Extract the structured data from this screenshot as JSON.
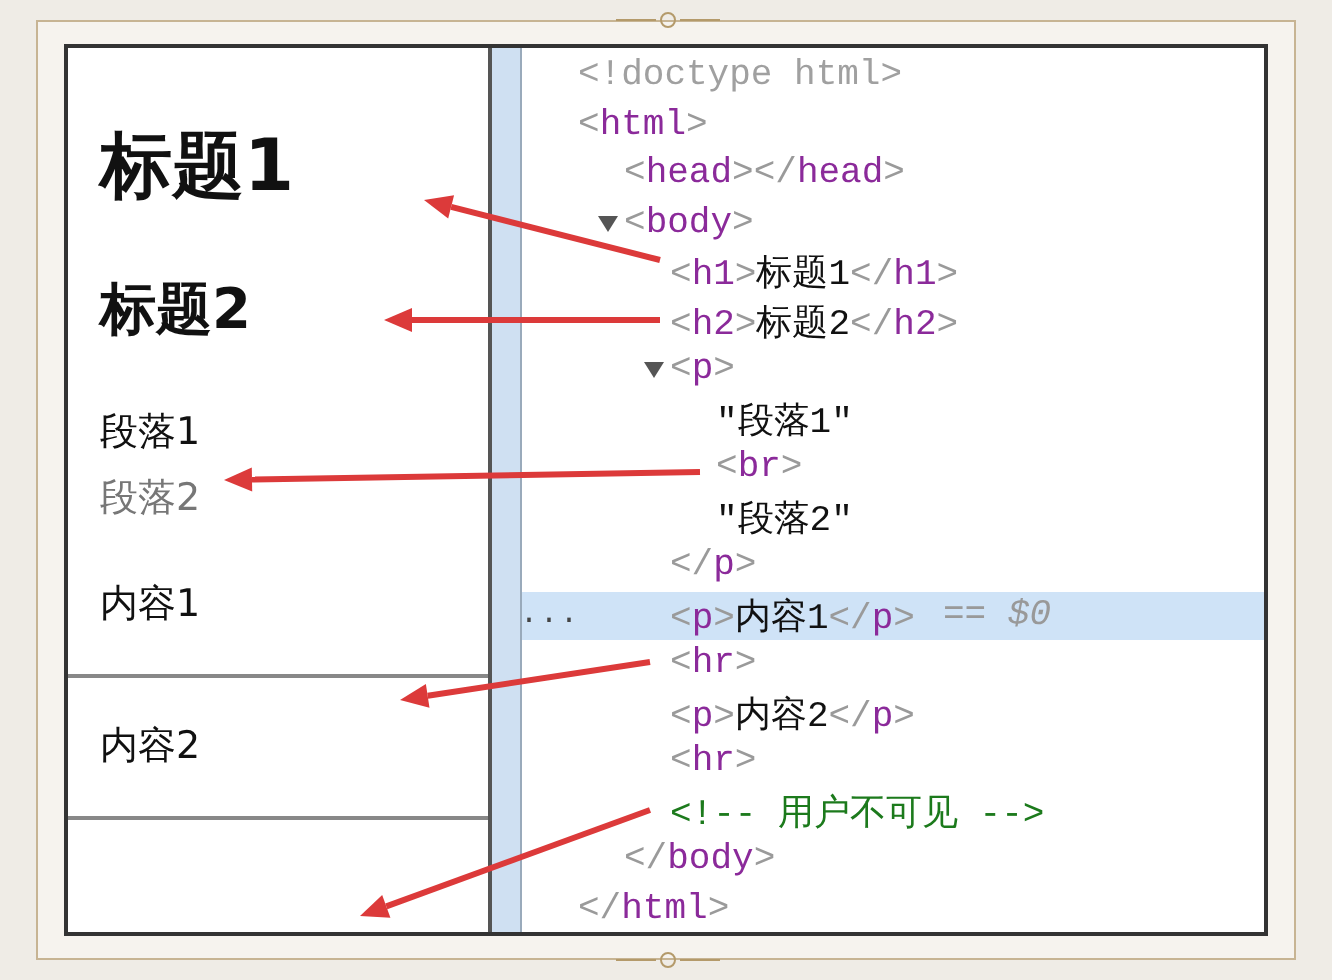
{
  "preview": {
    "items": [
      {
        "kind": "heading1",
        "text": "标题1"
      },
      {
        "kind": "heading2",
        "text": "标题2"
      },
      {
        "kind": "paragraph",
        "text": "段落1"
      },
      {
        "kind": "faded",
        "text": "段落2"
      },
      {
        "kind": "paragraph",
        "text": "内容1"
      },
      {
        "kind": "rule"
      },
      {
        "kind": "paragraph",
        "text": "内容2"
      },
      {
        "kind": "rule"
      }
    ]
  },
  "dom_tree": {
    "nodes": [
      {
        "kind": "doctype",
        "open": "<!doctype html>",
        "selected": false
      },
      {
        "kind": "element",
        "open": "<html>",
        "closing": "</html>",
        "selected": false,
        "children": [
          {
            "kind": "element",
            "open": "<head>",
            "close": "</head>",
            "selected": false
          },
          {
            "kind": "element",
            "open": "<body>",
            "closing": "</body>",
            "expanded": true,
            "selected": false,
            "children": [
              {
                "kind": "element",
                "open": "<h1>",
                "content": "标题1",
                "close": "</h1>",
                "selected": false
              },
              {
                "kind": "element",
                "open": "<h2>",
                "content": "标题2",
                "close": "</h2>",
                "selected": false
              },
              {
                "kind": "element",
                "open": "<p>",
                "closing": "</p>",
                "expanded": true,
                "selected": false,
                "children": [
                  {
                    "kind": "text",
                    "content": "\"段落1\"",
                    "selected": false
                  },
                  {
                    "kind": "element",
                    "open": "<br>",
                    "selected": false
                  },
                  {
                    "kind": "text",
                    "content": "\"段落2\"",
                    "selected": false
                  }
                ]
              },
              {
                "kind": "element",
                "open": "<p>",
                "content": "内容1",
                "close": "</p>",
                "selected": true,
                "marker": "...",
                "suffix": "== $0"
              },
              {
                "kind": "element",
                "open": "<hr>",
                "selected": false
              },
              {
                "kind": "element",
                "open": "<p>",
                "content": "内容2",
                "close": "</p>",
                "selected": false
              },
              {
                "kind": "element",
                "open": "<hr>",
                "selected": false
              },
              {
                "kind": "comment",
                "content": "<!-- 用户不可见 -->",
                "selected": false
              }
            ]
          }
        ]
      }
    ]
  }
}
